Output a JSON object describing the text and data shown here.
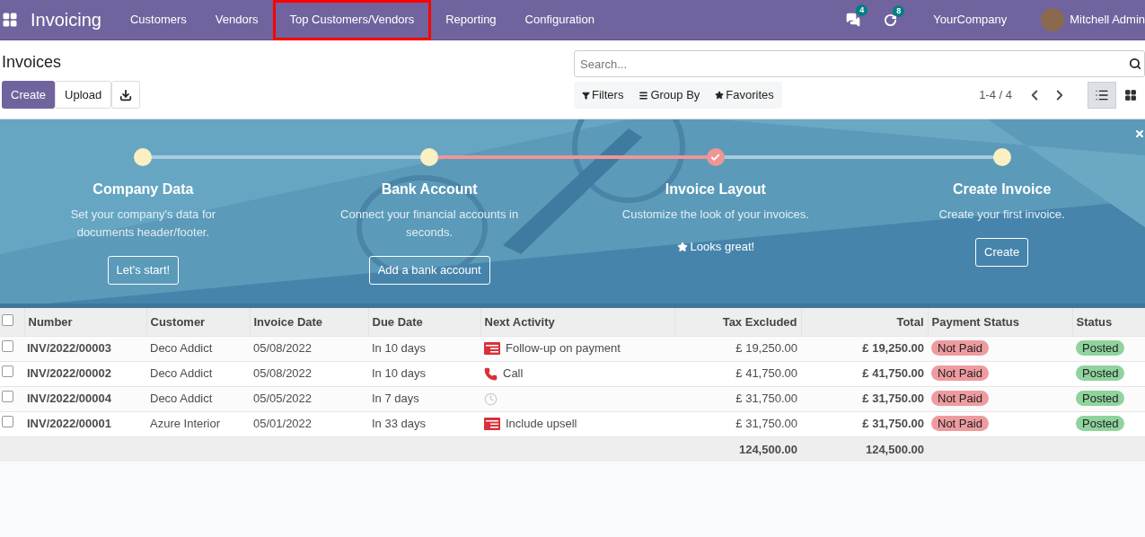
{
  "navbar": {
    "app_name": "Invoicing",
    "menu": [
      {
        "label": "Customers",
        "highlighted": false
      },
      {
        "label": "Vendors",
        "highlighted": false
      },
      {
        "label": "Top Customers/Vendors",
        "highlighted": true
      },
      {
        "label": "Reporting",
        "highlighted": false
      },
      {
        "label": "Configuration",
        "highlighted": false
      }
    ],
    "messages_count": "4",
    "activities_count": "8",
    "company": "YourCompany",
    "user": "Mitchell Admin"
  },
  "control_panel": {
    "title": "Invoices",
    "buttons": [
      "Create",
      "Upload"
    ],
    "search": {
      "placeholder": "Search..."
    },
    "filters": [
      "Filters",
      "Group By",
      "Favorites"
    ],
    "pager": "1-4 / 4",
    "views": [
      {
        "kind": "list",
        "selected": true
      },
      {
        "kind": "kanban",
        "selected": false
      }
    ]
  },
  "onboarding": {
    "steps": [
      {
        "title": "Company Data",
        "description": "Set your company's data for documents header/footer.",
        "done": false,
        "action": "Let's start!"
      },
      {
        "title": "Bank Account",
        "description": "Connect your financial accounts in seconds.",
        "done": false,
        "action": "Add a bank account"
      },
      {
        "title": "Invoice Layout",
        "description": "Customize the look of your invoices.",
        "done": true,
        "action": "Looks great!"
      },
      {
        "title": "Create Invoice",
        "description": "Create your first invoice.",
        "done": false,
        "action": "Create"
      }
    ]
  },
  "table": {
    "all_checked": false,
    "columns": [
      "Number",
      "Customer",
      "Invoice Date",
      "Due Date",
      "Next Activity",
      "Tax Excluded",
      "Total",
      "Payment Status",
      "Status"
    ],
    "rows": [
      {
        "checked": false,
        "number": "INV/2022/00003",
        "customer": "Deco Addict",
        "invoice_date": "05/08/2022",
        "due_date": "In 10 days",
        "activity": {
          "kind": "todo",
          "label": "Follow-up on payment"
        },
        "tax_excluded": "£ 19,250.00",
        "total": "£ 19,250.00",
        "payment_status": "Not Paid",
        "status": "Posted"
      },
      {
        "checked": false,
        "number": "INV/2022/00002",
        "customer": "Deco Addict",
        "invoice_date": "05/08/2022",
        "due_date": "In 10 days",
        "activity": {
          "kind": "call",
          "label": "Call"
        },
        "tax_excluded": "£ 41,750.00",
        "total": "£ 41,750.00",
        "payment_status": "Not Paid",
        "status": "Posted"
      },
      {
        "checked": false,
        "number": "INV/2022/00004",
        "customer": "Deco Addict",
        "invoice_date": "05/05/2022",
        "due_date": "In 7 days",
        "activity": {
          "kind": "none"
        },
        "tax_excluded": "£ 31,750.00",
        "total": "£ 31,750.00",
        "payment_status": "Not Paid",
        "status": "Posted"
      },
      {
        "checked": false,
        "number": "INV/2022/00001",
        "customer": "Azure Interior",
        "invoice_date": "05/01/2022",
        "due_date": "In 33 days",
        "activity": {
          "kind": "todo",
          "label": "Include upsell"
        },
        "tax_excluded": "£ 31,750.00",
        "total": "£ 31,750.00",
        "payment_status": "Not Paid",
        "status": "Posted"
      }
    ],
    "totals": {
      "tax_excluded": "124,500.00",
      "total": "124,500.00"
    }
  }
}
